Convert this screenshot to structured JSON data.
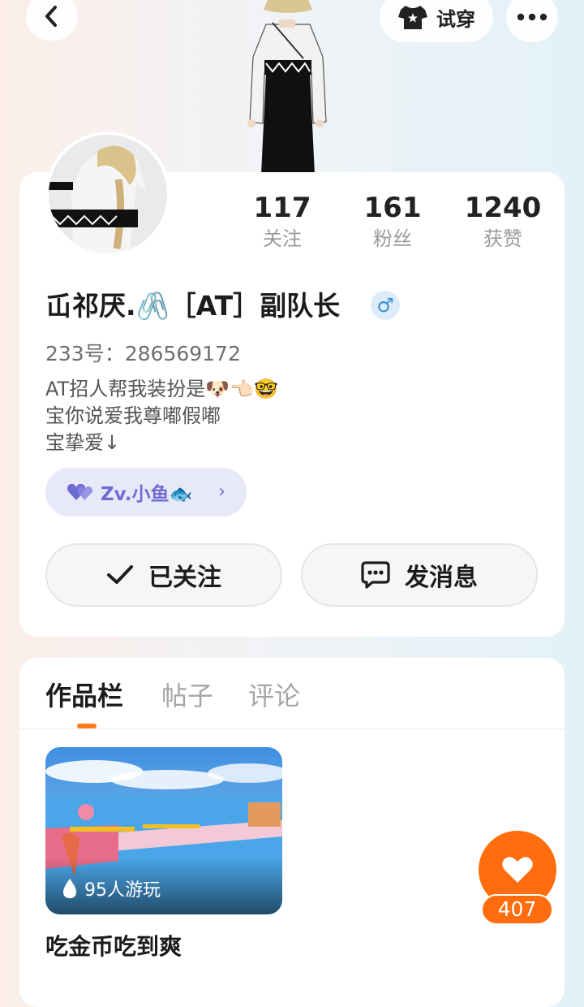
{
  "topbar": {
    "back_icon": "chevron-left-icon",
    "tryon_label": "试穿",
    "tryon_icon": "shirt-icon",
    "more_icon": "more-dots-icon"
  },
  "profile": {
    "stats": [
      {
        "value": "117",
        "label": "关注"
      },
      {
        "value": "161",
        "label": "粉丝"
      },
      {
        "value": "1240",
        "label": "获赞"
      }
    ],
    "name": "屲祁厌.🖇️［AT］副队长",
    "gender": "♂",
    "uid": "233号：286569172",
    "bio_lines": [
      "AT招人帮我装扮是🐶👈🏻🤓",
      "宝你说爱我尊嘟假嘟",
      "宝挚爱↓"
    ],
    "fan_badge": "Zv.小鱼🐟",
    "followed_label": "已关注",
    "message_label": "发消息",
    "accent_color": "#ff6d0e"
  },
  "tabs": [
    {
      "label": "作品栏",
      "active": true
    },
    {
      "label": "帖子",
      "active": false
    },
    {
      "label": "评论",
      "active": false
    }
  ],
  "works": [
    {
      "title": "吃金币吃到爽",
      "plays": "95人游玩"
    }
  ],
  "like": {
    "count": "407",
    "icon": "heart-icon"
  }
}
